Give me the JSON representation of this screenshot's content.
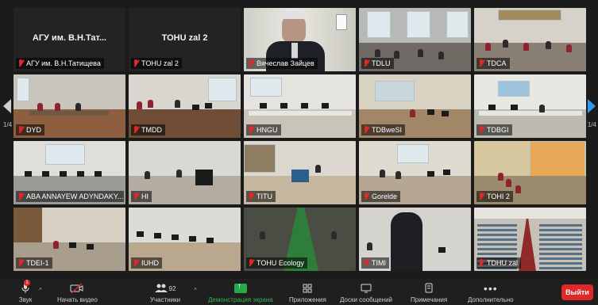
{
  "pagination": {
    "left": "1/4",
    "right": "1/4"
  },
  "tiles": [
    {
      "label": "АГУ им. В.Н.Татищева",
      "big_name": "АГУ им. В.Н.Тат..."
    },
    {
      "label": "TOHU zal 2",
      "big_name": "TOHU zal 2"
    },
    {
      "label": "Вячеслав Зайцев"
    },
    {
      "label": "TDLU"
    },
    {
      "label": "TDCA"
    },
    {
      "label": "DYD"
    },
    {
      "label": "TMDD"
    },
    {
      "label": "HNGU"
    },
    {
      "label": "TDBweSI"
    },
    {
      "label": "TDBGI"
    },
    {
      "label": "ABA ANNAYEW ADYNDAKY..."
    },
    {
      "label": "HI"
    },
    {
      "label": "TITU"
    },
    {
      "label": "Gorelde"
    },
    {
      "label": "TOHI 2"
    },
    {
      "label": "TDEI-1"
    },
    {
      "label": "IUHD"
    },
    {
      "label": "TOHU Ecology"
    },
    {
      "label": "TIMI"
    },
    {
      "label": "TDHU zal"
    }
  ],
  "toolbar": {
    "audio_label": "Звук",
    "video_label": "Начать видео",
    "participants_label": "Участники",
    "participants_count": "92",
    "share_label": "Демонстрация экрана",
    "apps_label": "Приложения",
    "chat_label": "Доски сообщений",
    "notes_label": "Примечания",
    "more_label": "Дополнительно",
    "end_label": "Выйти",
    "mic_badge": "1"
  },
  "colors": {
    "accent": "#2b9bf0",
    "share_green": "#25a94b",
    "end_red": "#e02828",
    "muted_red": "#e02828"
  }
}
